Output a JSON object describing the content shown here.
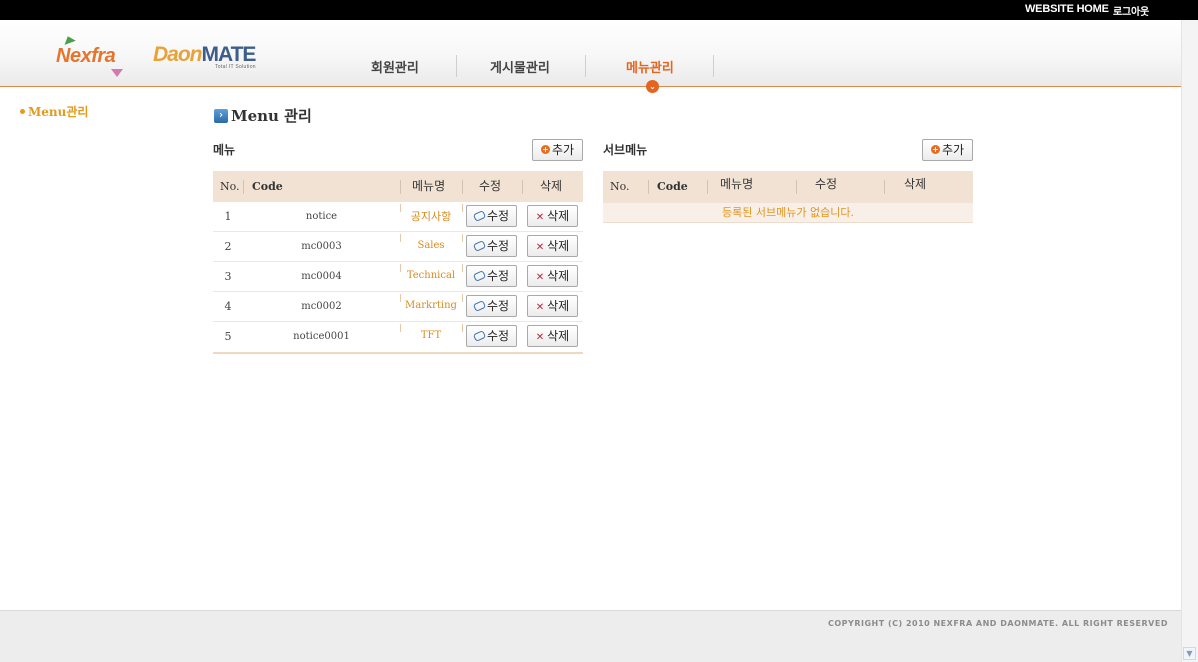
{
  "topbar": {
    "website_home": "WEBSITE HOME",
    "logout": "로그아웃"
  },
  "brand": {
    "nexfra": "Nexfra",
    "daon": "Daon",
    "mate": "MATE",
    "daon_tagline": "Total IT Solution"
  },
  "nav": {
    "items": [
      {
        "label": "회원관리",
        "active": false
      },
      {
        "label": "게시물관리",
        "active": false
      },
      {
        "label": "메뉴관리",
        "active": true
      }
    ]
  },
  "sidebar": {
    "items": [
      {
        "label": "Menu관리"
      }
    ]
  },
  "page": {
    "title": "Menu 관리"
  },
  "menu_section": {
    "label": "메뉴",
    "add_label": "추가",
    "columns": [
      "No.",
      "Code",
      "메뉴명",
      "수정",
      "삭제"
    ],
    "rows": [
      {
        "no": "1",
        "code": "notice",
        "name": "공지사항",
        "edit": "수정",
        "delete": "삭제"
      },
      {
        "no": "2",
        "code": "mc0003",
        "name": "Sales",
        "edit": "수정",
        "delete": "삭제"
      },
      {
        "no": "3",
        "code": "mc0004",
        "name": "Technical",
        "edit": "수정",
        "delete": "삭제"
      },
      {
        "no": "4",
        "code": "mc0002",
        "name": "Markrting",
        "edit": "수정",
        "delete": "삭제"
      },
      {
        "no": "5",
        "code": "notice0001",
        "name": "TFT",
        "edit": "수정",
        "delete": "삭제"
      }
    ]
  },
  "submenu_section": {
    "label": "서브메뉴",
    "add_label": "추가",
    "columns": [
      "No.",
      "Code",
      "메뉴명",
      "수정",
      "삭제"
    ],
    "empty_message": "등록된 서브메뉴가 없습니다."
  },
  "footer": {
    "copyright": "COPYRIGHT (C) 2010 NEXFRA AND DAONMATE. ALL RIGHT RESERVED"
  },
  "colors": {
    "accent": "#e5641f",
    "menu_name": "#d98a1f",
    "header_row": "#f2e2d4"
  }
}
